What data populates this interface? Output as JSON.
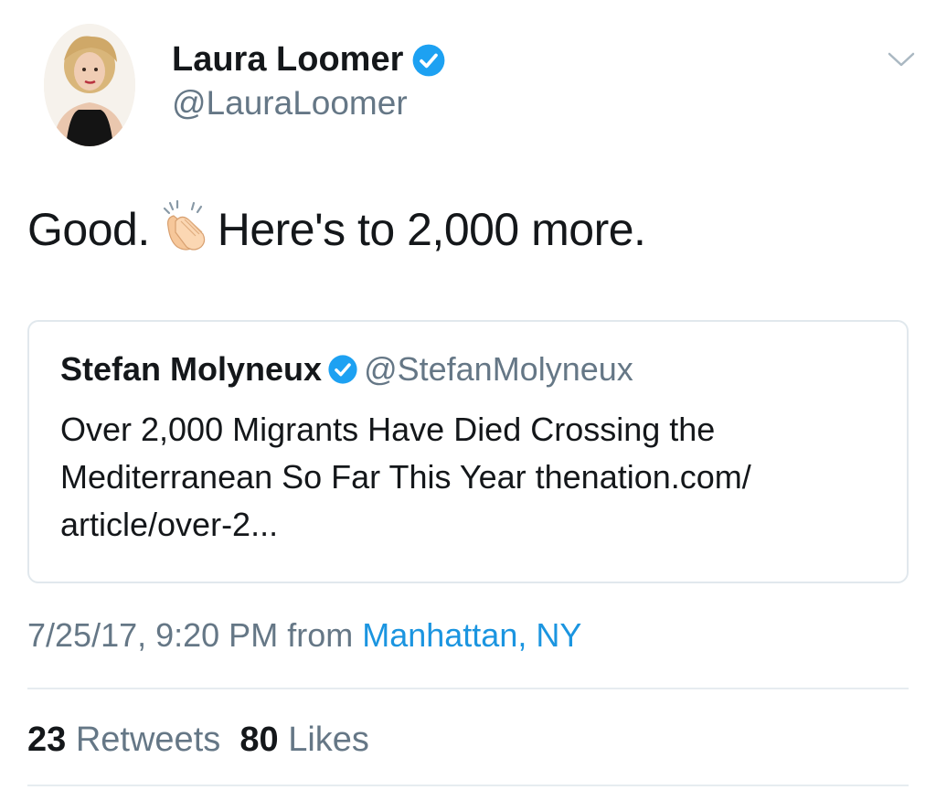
{
  "tweet": {
    "author": {
      "name": "Laura Loomer",
      "handle": "@LauraLoomer",
      "verified": true
    },
    "text_before_emoji": "Good.",
    "emoji": "clapping-hands",
    "text_after_emoji": "Here's to 2,000 more.",
    "quoted": {
      "name": "Stefan Molyneux",
      "handle": "@StefanMolyneux",
      "verified": true,
      "text": "Over 2,000 Migrants Have Died Crossing the Mediterranean So Far This Year ",
      "link": "thenation.com/ article/over-2..."
    },
    "timestamp": "7/25/17, 9:20 PM",
    "from_label": "from",
    "location": "Manhattan, NY",
    "retweets_count": "23",
    "retweets_label": "Retweets",
    "likes_count": "80",
    "likes_label": "Likes"
  },
  "colors": {
    "accent": "#1b95e0",
    "verified": "#1da1f2",
    "secondary_text": "#657786",
    "border": "#e1e8ed"
  }
}
